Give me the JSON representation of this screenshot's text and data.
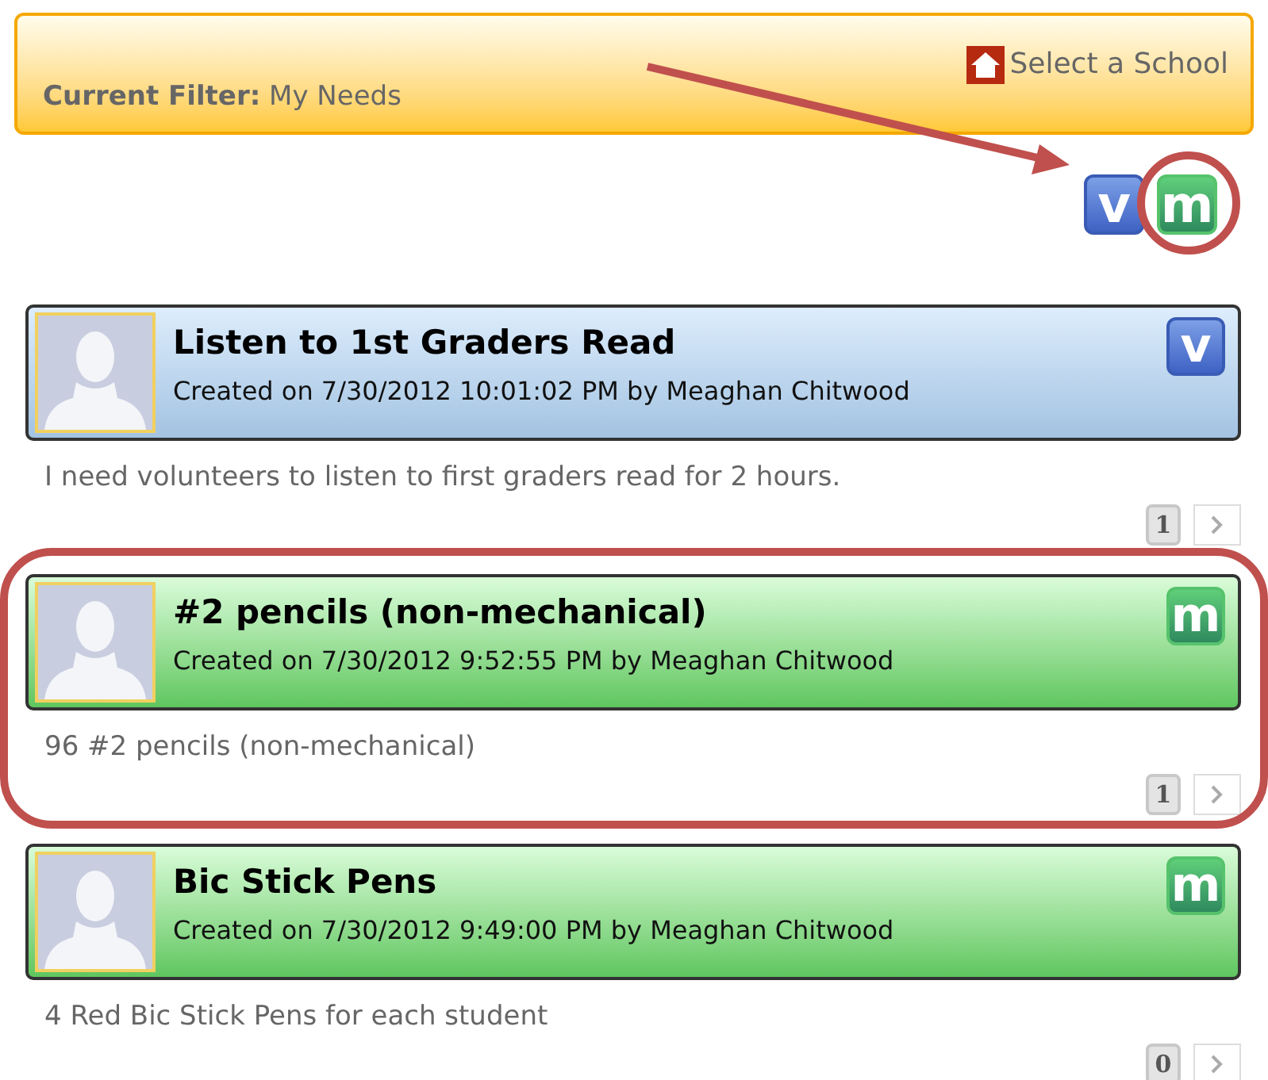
{
  "filter_bar": {
    "current_filter": "**Current Filter:** My Needs",
    "select_school": "Select a School"
  },
  "type_filters": [
    {
      "kind": "volunteer",
      "badge": "v"
    },
    {
      "kind": "material",
      "badge": "m"
    }
  ],
  "needs": [
    {
      "kind": "volunteer",
      "badge": "v",
      "title": "Listen to 1st Graders Read",
      "created": "Created on 7/30/2012 10:01:02 PM by Meaghan Chitwood",
      "description": "I need volunteers to listen to first graders read for 2 hours.",
      "count": "1",
      "highlighted": false
    },
    {
      "kind": "material",
      "badge": "m",
      "title": "#2 pencils (non-mechanical)",
      "created": "Created on 7/30/2012 9:52:55 PM by Meaghan Chitwood",
      "description": "96 #2 pencils (non-mechanical)",
      "count": "1",
      "highlighted": true
    },
    {
      "kind": "material",
      "badge": "m",
      "title": "Bic Stick Pens",
      "created": "Created on 7/30/2012 9:49:00 PM by Meaghan Chitwood",
      "description": "4 Red Bic Stick Pens for each student",
      "count": "0",
      "highlighted": false
    }
  ]
}
